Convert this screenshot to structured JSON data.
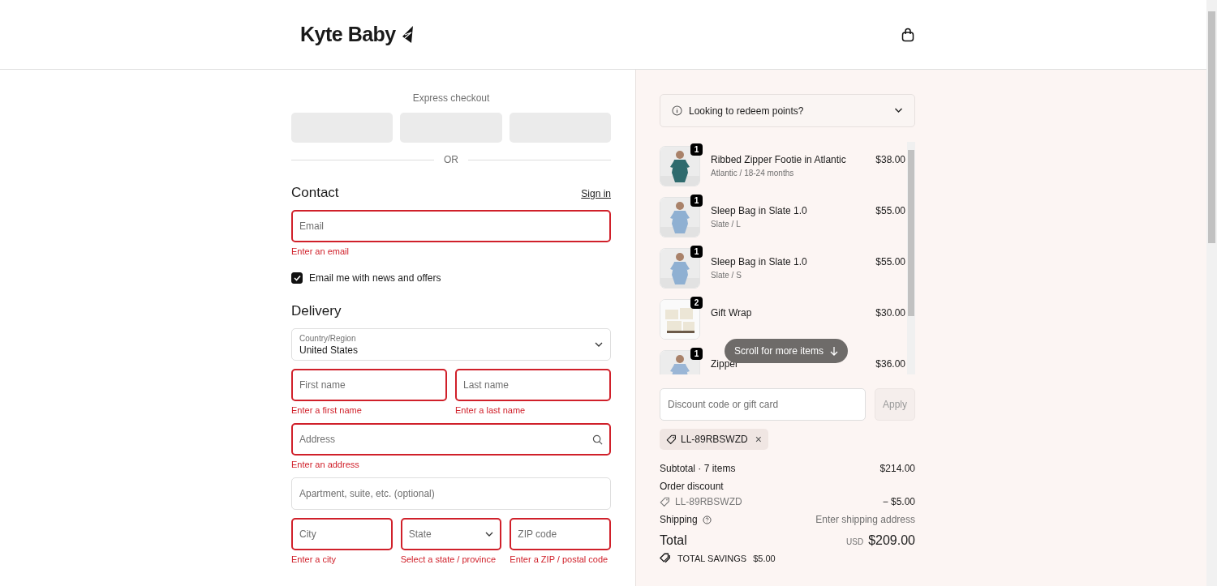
{
  "header": {
    "brand": "Kyte Baby"
  },
  "express": {
    "title": "Express checkout",
    "divider": "OR"
  },
  "contact": {
    "heading": "Contact",
    "sign_in": "Sign in",
    "email": {
      "placeholder": "Email",
      "error": "Enter an email",
      "invalid": true
    },
    "newsletter": {
      "label": "Email me with news and offers",
      "checked": true
    }
  },
  "delivery": {
    "heading": "Delivery",
    "rows": [
      [
        {
          "kind": "select",
          "label": "Country/Region",
          "value": "United States",
          "invalid": false
        }
      ],
      [
        {
          "kind": "text",
          "placeholder": "First name",
          "error": "Enter a first name",
          "invalid": true
        },
        {
          "kind": "text",
          "placeholder": "Last name",
          "error": "Enter a last name",
          "invalid": true
        }
      ],
      [
        {
          "kind": "search",
          "placeholder": "Address",
          "error": "Enter an address",
          "invalid": true
        }
      ],
      [
        {
          "kind": "text",
          "placeholder": "Apartment, suite, etc. (optional)",
          "invalid": false
        }
      ],
      [
        {
          "kind": "text",
          "placeholder": "City",
          "error": "Enter a city",
          "invalid": true
        },
        {
          "kind": "dropdown",
          "placeholder": "State",
          "error": "Select a state / province",
          "invalid": true
        },
        {
          "kind": "text",
          "placeholder": "ZIP code",
          "error": "Enter a ZIP / postal code",
          "invalid": true
        }
      ]
    ]
  },
  "summary": {
    "redeem": {
      "label": "Looking to redeem points?",
      "expanded": false
    },
    "items": [
      {
        "name": "Ribbed Zipper Footie in Atlantic",
        "variant": "Atlantic / 18-24 months",
        "price": "$38.00",
        "quantity": "1"
      },
      {
        "name": "Sleep Bag in Slate 1.0",
        "variant": "Slate / L",
        "price": "$55.00",
        "quantity": "1"
      },
      {
        "name": "Sleep Bag in Slate 1.0",
        "variant": "Slate / S",
        "price": "$55.00",
        "quantity": "1"
      },
      {
        "name": "Gift Wrap",
        "price": "$30.00",
        "quantity": "2"
      },
      {
        "name": "Zipper",
        "price": "$36.00",
        "quantity": "1"
      }
    ],
    "scroll_hint": "Scroll for more items",
    "discount": {
      "placeholder": "Discount code or gift card",
      "apply": "Apply"
    },
    "applied_code": {
      "code": "LL-89RBSWZD",
      "remove": "×"
    },
    "subtotal": {
      "label": "Subtotal · 7 items",
      "value": "$214.00"
    },
    "order_discount": {
      "label": "Order discount",
      "code": "LL-89RBSWZD",
      "value": "− $5.00"
    },
    "shipping": {
      "label": "Shipping",
      "value": "Enter shipping address"
    },
    "total": {
      "label": "Total",
      "currency": "USD",
      "value": "$209.00"
    },
    "savings": {
      "label": "TOTAL SAVINGS",
      "value": "$5.00"
    }
  }
}
